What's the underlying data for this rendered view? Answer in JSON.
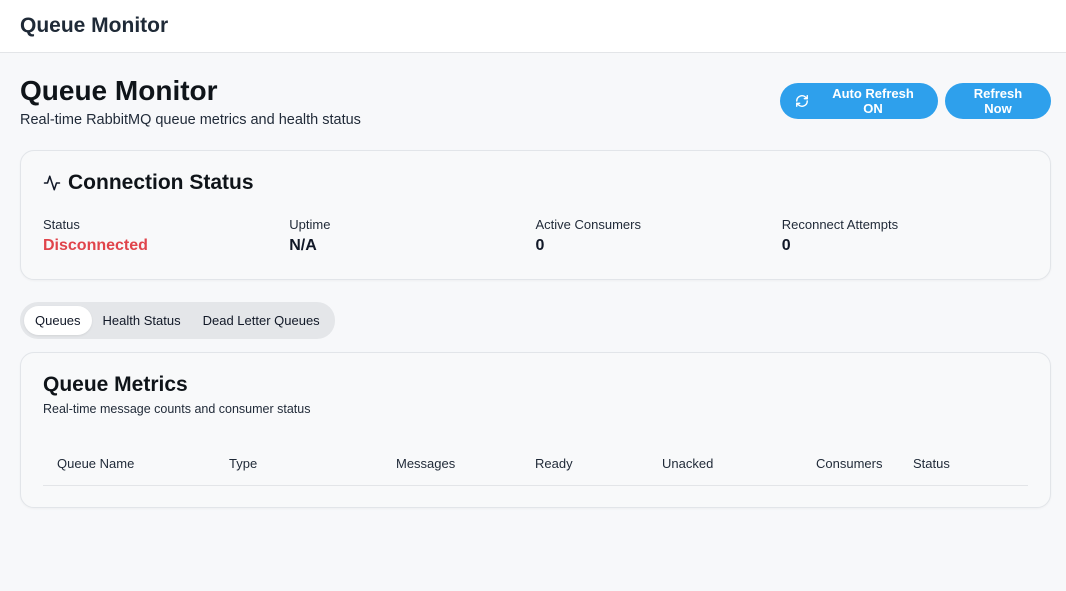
{
  "app": {
    "topbar_title": "Queue Monitor"
  },
  "header": {
    "title": "Queue Monitor",
    "subtitle": "Real-time RabbitMQ queue metrics and health status",
    "auto_refresh_label": "Auto Refresh ON",
    "refresh_now_label": "Refresh Now"
  },
  "connection": {
    "title": "Connection Status",
    "stats": [
      {
        "label": "Status",
        "value": "Disconnected"
      },
      {
        "label": "Uptime",
        "value": "N/A"
      },
      {
        "label": "Active Consumers",
        "value": "0"
      },
      {
        "label": "Reconnect Attempts",
        "value": "0"
      }
    ]
  },
  "tabs": [
    {
      "label": "Queues",
      "active": true
    },
    {
      "label": "Health Status",
      "active": false
    },
    {
      "label": "Dead Letter Queues",
      "active": false
    }
  ],
  "metrics": {
    "title": "Queue Metrics",
    "subtitle": "Real-time message counts and consumer status",
    "columns": [
      "Queue Name",
      "Type",
      "Messages",
      "Ready",
      "Unacked",
      "Consumers",
      "Status"
    ],
    "rows": []
  },
  "colors": {
    "accent": "#2ea0ec",
    "status_bad": "#e0444b"
  },
  "icons": {
    "auto_refresh": "refresh-icon",
    "connection": "activity-icon"
  }
}
